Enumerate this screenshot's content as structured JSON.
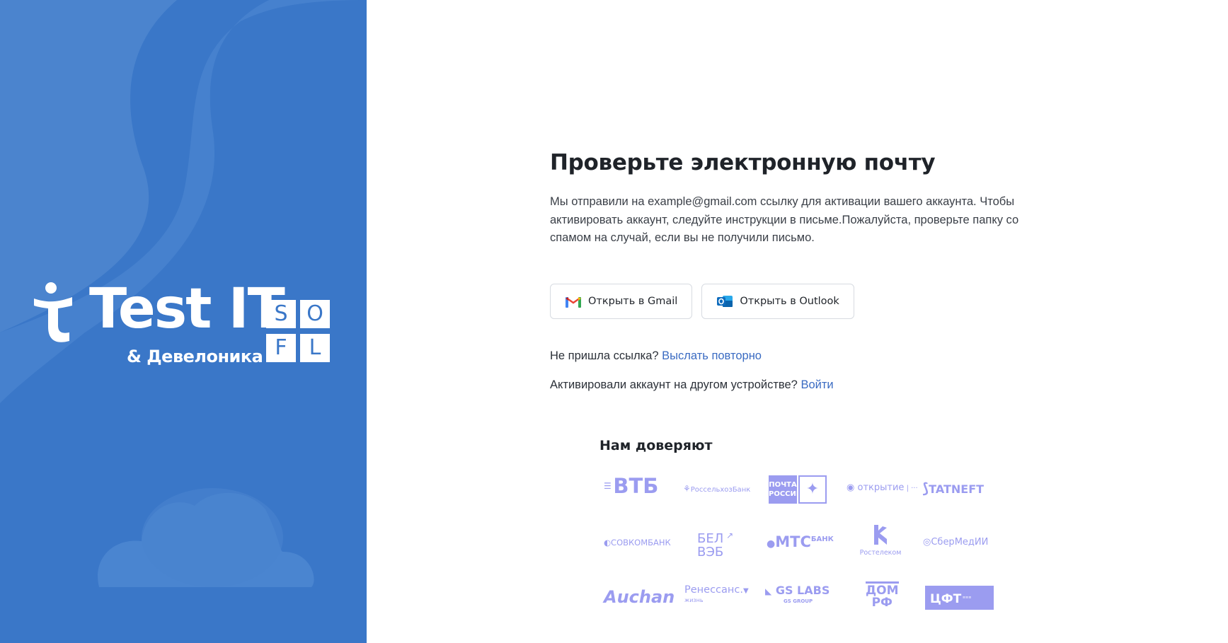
{
  "brand": {
    "logo_text": "Test IT",
    "logo_subtitle": "& Девелоника",
    "sofl_letters": [
      "S",
      "O",
      "F",
      "L"
    ],
    "background_color": "#3a77c8"
  },
  "main": {
    "title": "Проверьте электронную почту",
    "description": "Мы отправили на example@gmail.com ссылку для активации вашего аккаунта. Чтобы активировать аккаунт, следуйте инструкции в письме.Пожалуйста, проверьте папку со спамом на случай, если вы не получили письмо.",
    "gmail_button": "Открыть в Gmail",
    "outlook_button": "Открыть в Outlook",
    "resend_prompt": "Не пришла ссылка?",
    "resend_link": "Выслать повторно",
    "login_prompt": "Активировали аккаунт на другом устройстве?",
    "login_link": "Войти",
    "link_color": "#3a6bc2"
  },
  "trust": {
    "title": "Нам доверяют",
    "logo_color": "#9b9cf0",
    "logos": {
      "vtb": "ВТБ",
      "rshb": "РоссельхозБанк",
      "pochta_top": "ПОЧТА",
      "pochta_bottom": "РОССИИ",
      "otkritie": "открытие",
      "tatneft": "TATNEFT",
      "sovcombank": "СОВКОМБАНК",
      "belveb_top": "БЕЛ",
      "belveb_bottom": "ВЭБ",
      "mts": "МТС",
      "mts_bank": "БАНК",
      "rostelecom": "Ростелеком",
      "sbermedia": "СберМедИИ",
      "auchan": "Auchan",
      "renaissance": "Ренессанс.",
      "renaissance_sub": "жизнь",
      "gslabs": "GS LABS",
      "gslabs_sub": "GS GROUP",
      "domrf_top": "ДОМ",
      "domrf_bottom": "РФ",
      "cft": "ЦФТ"
    }
  }
}
